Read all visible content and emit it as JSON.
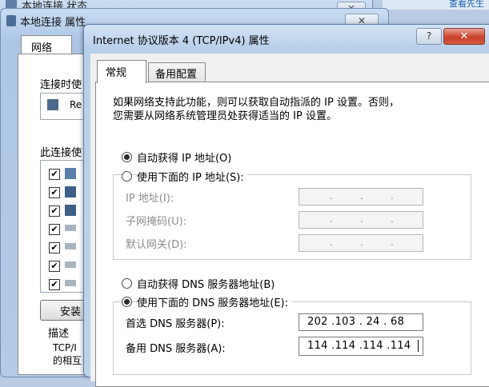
{
  "top_right_peek": {
    "text": "查看先生"
  },
  "status_window": {
    "title": "本地连接 状态",
    "close_glyph": "✕"
  },
  "props_window": {
    "title": "本地连接 属性",
    "close_glyph": "✕",
    "tab_network": "网络",
    "connect_using_label": "连接时使",
    "adapter_text": "Re",
    "items_label": "此连接使",
    "install_button": "安装",
    "description_label": "描述",
    "description_text_1": "TCP/I",
    "description_text_2": "的相互"
  },
  "ipv4_window": {
    "title": "Internet 协议版本 4 (TCP/IPv4) 属性",
    "help_glyph": "?",
    "close_glyph": "✕",
    "tabs": [
      "常规",
      "备用配置"
    ],
    "info_line_1": "如果网络支持此功能，则可以获取自动指派的 IP 设置。否则，",
    "info_line_2": "您需要从网络系统管理员处获得适当的 IP 设置。",
    "ip_auto_label": "自动获得 IP 地址(O)",
    "ip_manual_label": "使用下面的 IP 地址(S):",
    "ip_address_label": "IP 地址(I):",
    "subnet_label": "子网掩码(U):",
    "gateway_label": "默认网关(D):",
    "dns_auto_label": "自动获得 DNS 服务器地址(B)",
    "dns_manual_label": "使用下面的 DNS 服务器地址(E):",
    "preferred_dns_label": "首选 DNS 服务器(P):",
    "alternate_dns_label": "备用 DNS 服务器(A):",
    "preferred_dns_value": "202 .103 . 24 . 68",
    "alternate_dns_value": "114 .114 .114 .114",
    "ip_auto_selected": true,
    "dns_manual_selected": true
  }
}
